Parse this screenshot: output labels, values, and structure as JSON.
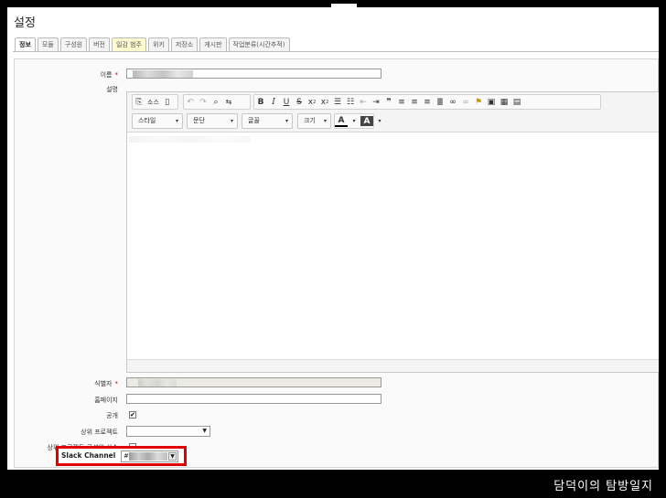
{
  "page": {
    "title": "설정"
  },
  "tabs": [
    {
      "label": "정보",
      "active": true
    },
    {
      "label": "모듈"
    },
    {
      "label": "구성원"
    },
    {
      "label": "버전"
    },
    {
      "label": "일감 범주",
      "highlight": true
    },
    {
      "label": "위키"
    },
    {
      "label": "저장소"
    },
    {
      "label": "게시판"
    },
    {
      "label": "작업분류(시간추적)"
    }
  ],
  "form": {
    "name_label": "이름",
    "required_mark": "*",
    "description_label": "설명",
    "identifier_label": "식별자",
    "homepage_label": "홈페이지",
    "public_label": "공개",
    "public_checked": true,
    "public_check_glyph": "✔",
    "parent_label": "상위 프로젝트",
    "inherit_label": "상위 프로젝트 구성원 상속",
    "inherit_checked": false,
    "slack_label": "Slack Channel",
    "slack_value_prefix": "#"
  },
  "editor": {
    "source_label": "소스",
    "combos": {
      "style": "스타일",
      "paragraph": "문단",
      "font": "글꼴",
      "size": "크기"
    },
    "icons": [
      "source-icon",
      "paste-icon",
      "undo-icon",
      "redo-icon",
      "find-icon",
      "replace-icon",
      "bold-icon",
      "italic-icon",
      "underline-icon",
      "strike-icon",
      "subscript-icon",
      "superscript-icon",
      "numbered-list-icon",
      "bullet-list-icon",
      "outdent-icon",
      "indent-icon",
      "blockquote-icon",
      "align-left-icon",
      "align-center-icon",
      "align-right-icon",
      "justify-icon",
      "link-icon",
      "unlink-icon",
      "anchor-icon",
      "image-icon",
      "table-icon",
      "horizontal-rule-icon",
      "text-color-icon",
      "bg-color-icon"
    ]
  },
  "watermark": "담덕이의 탐방일지",
  "colors": {
    "highlight_border": "#e00000",
    "required": "#cc0000"
  }
}
